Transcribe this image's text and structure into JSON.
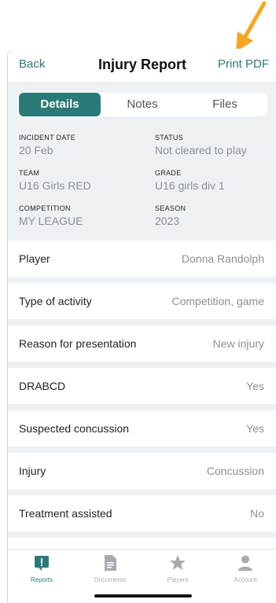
{
  "nav": {
    "back_label": "Back",
    "title": "Injury Report",
    "print_label": "Print PDF"
  },
  "segments": {
    "details": "Details",
    "notes": "Notes",
    "files": "Files"
  },
  "summary": {
    "incident_date": {
      "label": "INCIDENT DATE",
      "value": "20 Feb"
    },
    "status": {
      "label": "STATUS",
      "value": "Not cleared to play"
    },
    "team": {
      "label": "TEAM",
      "value": "U16 Girls RED"
    },
    "grade": {
      "label": "GRADE",
      "value": "U16 girls div 1"
    },
    "competition": {
      "label": "COMPETITION",
      "value": "MY LEAGUE"
    },
    "season": {
      "label": "SEASON",
      "value": "2023"
    }
  },
  "rows": [
    {
      "label": "Player",
      "value": "Donna Randolph"
    },
    {
      "label": "Type of activity",
      "value": "Competition, game"
    },
    {
      "label": "Reason for presentation",
      "value": "New injury"
    },
    {
      "label": "DRABCD",
      "value": "Yes"
    },
    {
      "label": "Suspected concussion",
      "value": "Yes"
    },
    {
      "label": "Injury",
      "value": "Concussion"
    },
    {
      "label": "Treatment assisted",
      "value": "No"
    }
  ],
  "tabbar": {
    "reports": "Reports",
    "documents": "Documents",
    "players": "Players",
    "account": "Account"
  },
  "colors": {
    "accent": "#2a7a78",
    "arrow": "#f5a623"
  }
}
